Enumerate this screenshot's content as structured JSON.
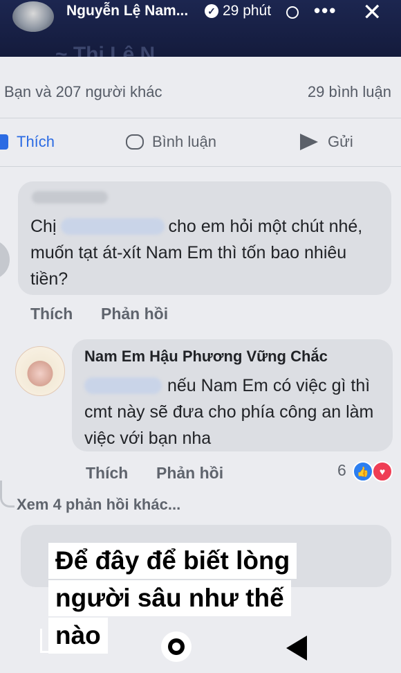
{
  "header": {
    "name": "Nguyễn Lệ Nam...",
    "time": "29 phút",
    "more_icon": "more-horizontal-icon",
    "close_icon": "close-icon"
  },
  "stats": {
    "reactions": "Bạn và 207 người khác",
    "comments": "29 bình luận"
  },
  "actions": {
    "like": "Thích",
    "comment": "Bình luận",
    "send": "Gửi"
  },
  "comment1": {
    "text_before": "Chị",
    "text_after": "cho em hỏi một chút nhé, muốn tạt át-xít Nam Em thì tốn bao nhiêu tiền?",
    "like": "Thích",
    "reply": "Phản hồi"
  },
  "comment2": {
    "name": "Nam Em Hậu Phương Vững Chắc",
    "text": "nếu Nam Em có việc gì thì cmt này sẽ đưa cho phía công an làm việc với bạn nha",
    "like": "Thích",
    "reply": "Phản hồi",
    "reaction_count": "6",
    "reaction_colors": {
      "like": "#2d7ff0",
      "love": "#ef3e55"
    }
  },
  "more_replies": "Xem 4 phản hồi khác...",
  "caption": {
    "line1": "Để đây để biết lòng",
    "line2": "người sâu như thế",
    "line3": "nào"
  },
  "colors": {
    "header_bg": "#1c2650",
    "accent": "#2b6be3",
    "panel_bg": "#ebecf0",
    "bubble_bg": "#dcdee3"
  }
}
